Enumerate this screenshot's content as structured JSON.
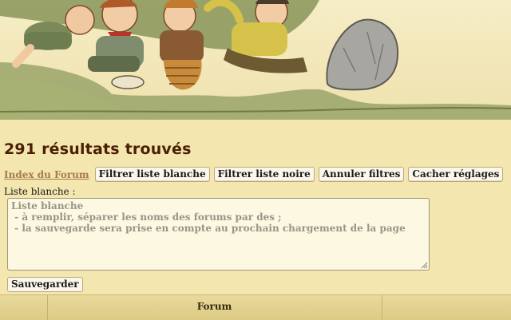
{
  "banner": {
    "image_name": "hobbits-laughing-banner"
  },
  "results": {
    "title": "291 résultats trouvés"
  },
  "toolbar": {
    "index_link": "Index du Forum",
    "buttons": [
      "Filtrer liste blanche",
      "Filtrer liste noire",
      "Annuler filtres",
      "Cacher réglages"
    ]
  },
  "whitelist": {
    "label": "Liste blanche :",
    "placeholder_lines": [
      "Liste blanche",
      " - à remplir, séparer les noms des forums par des ;",
      " - la sauvegarde sera prise en compte au prochain chargement de la page"
    ]
  },
  "save_label": "Sauvegarder",
  "table": {
    "columns": [
      "",
      "Forum",
      ""
    ]
  },
  "colors": {
    "page_bg": "#f3e6ae",
    "title": "#4a1f05",
    "link": "#a67c4e",
    "placeholder": "#9a9388"
  }
}
